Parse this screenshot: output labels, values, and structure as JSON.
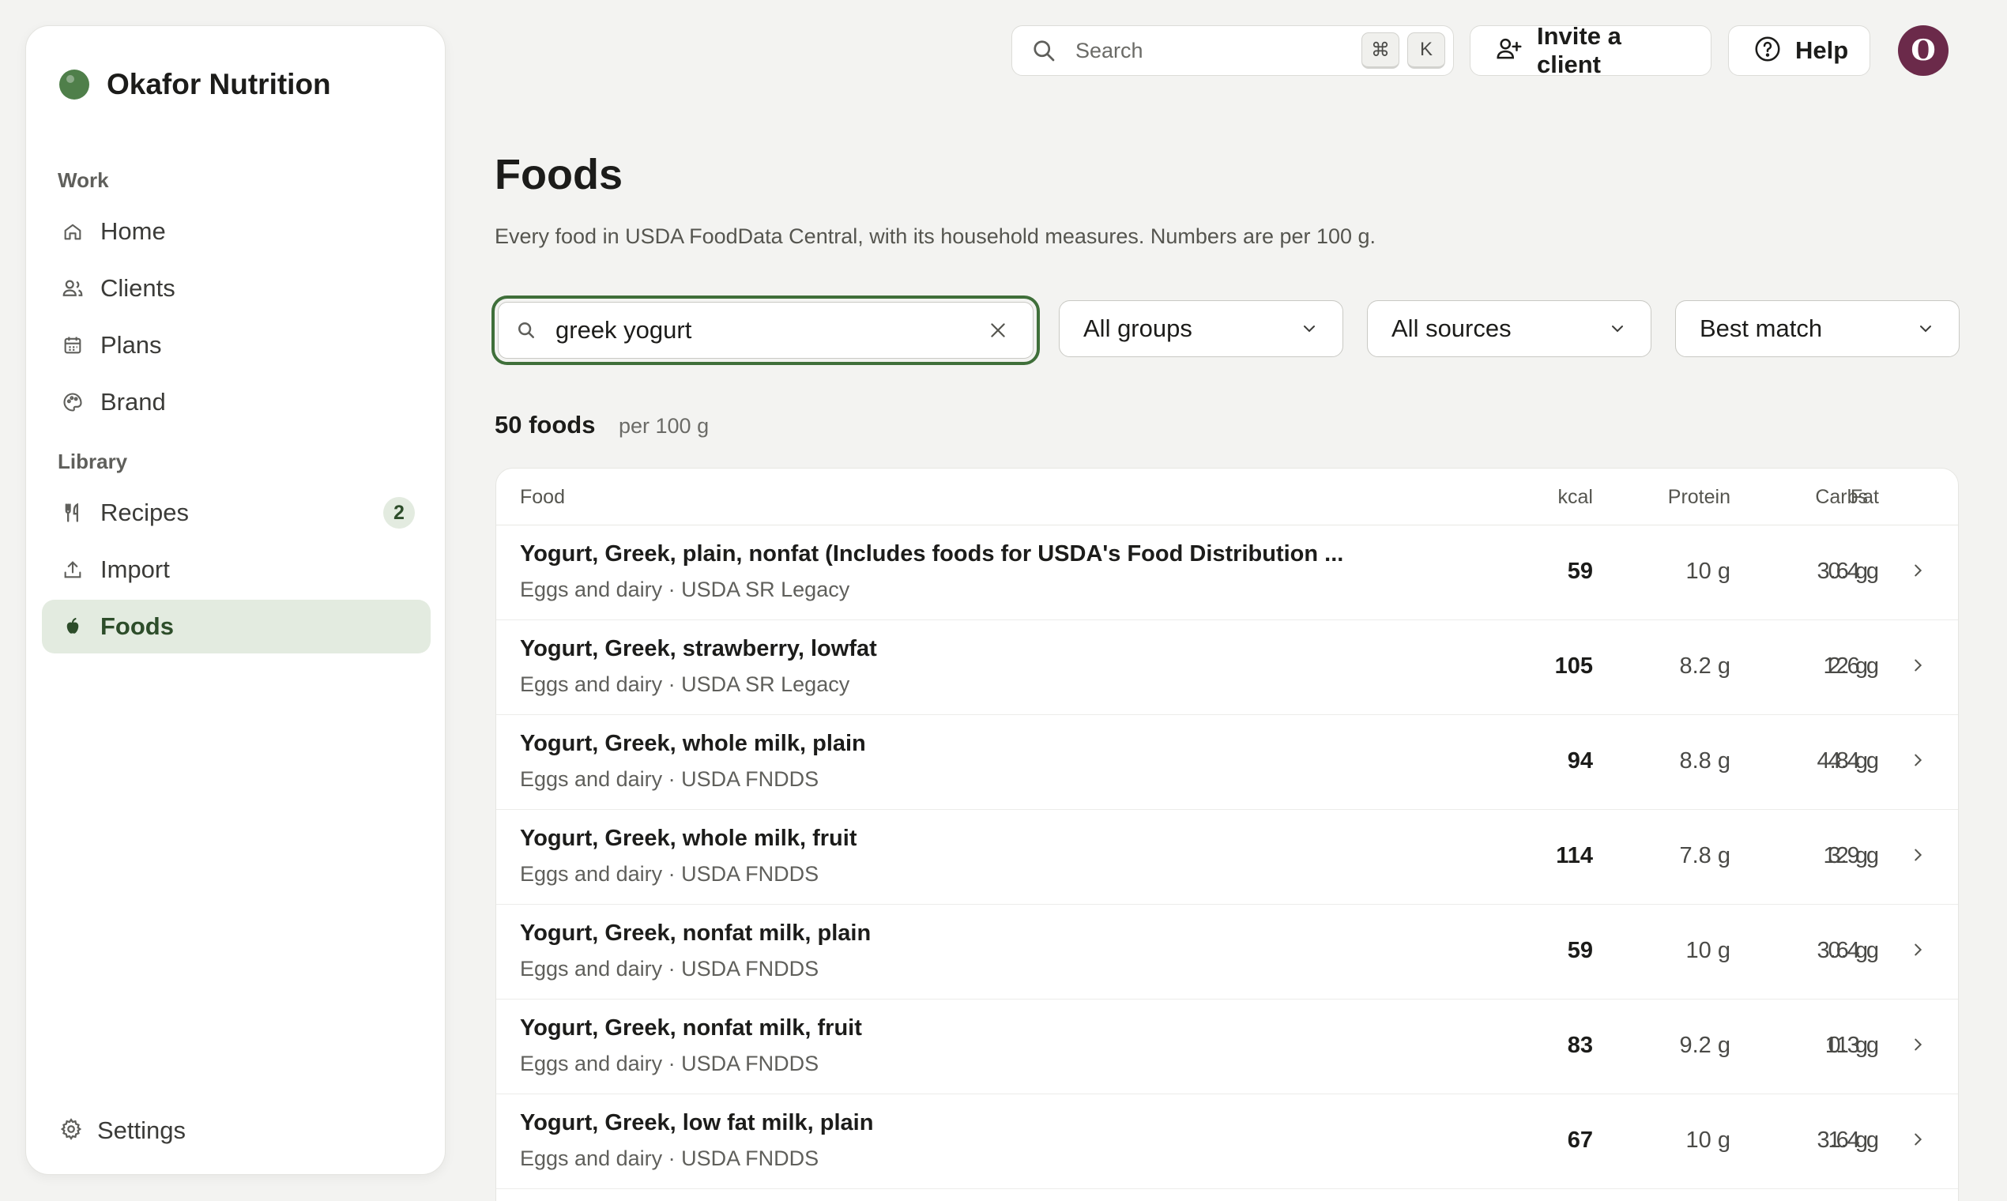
{
  "brand": {
    "name": "Okafor Nutrition"
  },
  "sidebar": {
    "groups": [
      {
        "label": "Work"
      },
      {
        "label": "Library"
      }
    ],
    "items": [
      {
        "label": "Home",
        "icon": "home-icon"
      },
      {
        "label": "Clients",
        "icon": "users-icon"
      },
      {
        "label": "Plans",
        "icon": "calendar-icon"
      },
      {
        "label": "Brand",
        "icon": "palette-icon"
      },
      {
        "label": "Recipes",
        "icon": "utensils-icon",
        "badge": "2"
      },
      {
        "label": "Import",
        "icon": "upload-icon"
      },
      {
        "label": "Foods",
        "icon": "apple-icon",
        "active": true
      }
    ],
    "settings_label": "Settings"
  },
  "topbar": {
    "search_placeholder": "Search",
    "shortcut_keys": [
      "⌘",
      "K"
    ],
    "invite_label": "Invite a client",
    "help_label": "Help",
    "avatar_initial": "O"
  },
  "page": {
    "title": "Foods",
    "subtitle": "Every food in USDA FoodData Central, with its household measures. Numbers are per 100 g."
  },
  "filters": {
    "search_value": "greek yogurt",
    "group": "All groups",
    "source": "All sources",
    "sort": "Best match"
  },
  "results": {
    "count": "50 foods",
    "unit": "per 100 g",
    "columns": [
      "Food",
      "kcal",
      "Protein",
      "Carbs",
      "Fat"
    ],
    "rows": [
      {
        "name": "Yogurt, Greek, plain, nonfat (Includes foods for USDA's Food Distribution ...",
        "meta": "Eggs and dairy · USDA SR Legacy",
        "kcal": "59",
        "protein": "10 g",
        "carbs": "3.6 g",
        "fat": "0.4 g"
      },
      {
        "name": "Yogurt, Greek, strawberry, lowfat",
        "meta": "Eggs and dairy · USDA SR Legacy",
        "kcal": "105",
        "protein": "8.2 g",
        "carbs": "12 g",
        "fat": "2.6 g"
      },
      {
        "name": "Yogurt, Greek, whole milk, plain",
        "meta": "Eggs and dairy · USDA FNDDS",
        "kcal": "94",
        "protein": "8.8 g",
        "carbs": "4.8 g",
        "fat": "4.4 g"
      },
      {
        "name": "Yogurt, Greek, whole milk, fruit",
        "meta": "Eggs and dairy · USDA FNDDS",
        "kcal": "114",
        "protein": "7.8 g",
        "carbs": "12 g",
        "fat": "3.9 g"
      },
      {
        "name": "Yogurt, Greek, nonfat milk, plain",
        "meta": "Eggs and dairy · USDA FNDDS",
        "kcal": "59",
        "protein": "10 g",
        "carbs": "3.6 g",
        "fat": "0.4 g"
      },
      {
        "name": "Yogurt, Greek, nonfat milk, fruit",
        "meta": "Eggs and dairy · USDA FNDDS",
        "kcal": "83",
        "protein": "9.2 g",
        "carbs": "11 g",
        "fat": "0.3 g"
      },
      {
        "name": "Yogurt, Greek, low fat milk, plain",
        "meta": "Eggs and dairy · USDA FNDDS",
        "kcal": "67",
        "protein": "10 g",
        "carbs": "3.6 g",
        "fat": "1.4 g"
      }
    ]
  },
  "colors": {
    "accent": "#3f6f3a",
    "brand_dot": "#4f7f4a",
    "active_bg": "#e3ebe0",
    "avatar": "#6b2a4a"
  }
}
